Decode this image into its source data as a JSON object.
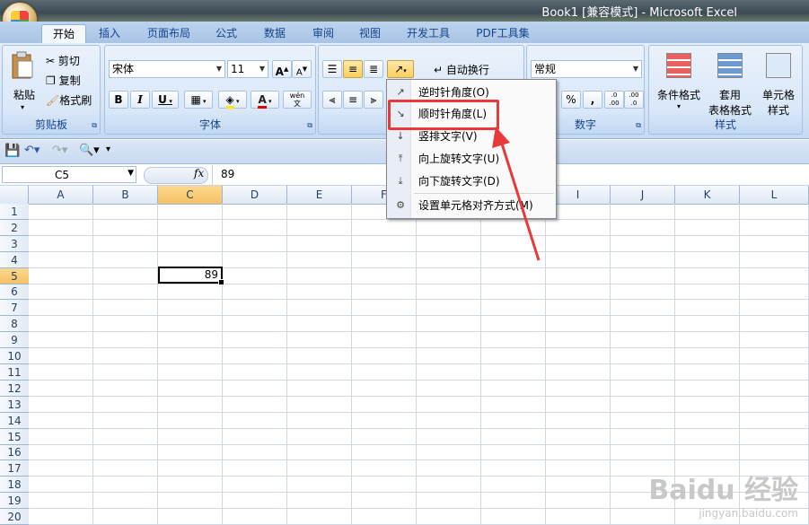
{
  "window": {
    "title": "Book1  [兼容模式] - Microsoft Excel"
  },
  "tabs": [
    "开始",
    "插入",
    "页面布局",
    "公式",
    "数据",
    "审阅",
    "视图",
    "开发工具",
    "PDF工具集"
  ],
  "clipboard": {
    "paste": "粘贴",
    "cut": "剪切",
    "copy": "复制",
    "format_painter": "格式刷",
    "label": "剪贴板"
  },
  "font": {
    "name": "宋体",
    "size": "11",
    "bold": "B",
    "italic": "I",
    "underline": "U",
    "font_color_glyph": "A",
    "phonetic": "wén",
    "label": "字体"
  },
  "alignment": {
    "wrap_text": "自动换行"
  },
  "number": {
    "format": "常规",
    "percent": "%",
    "comma": ",",
    "inc_decimal": ".0 .00",
    "dec_decimal": ".00 .0",
    "label": "数字"
  },
  "styles": {
    "conditional": "条件格式",
    "table_format_1": "套用",
    "table_format_2": "表格格式",
    "cell_styles_1": "单元格",
    "cell_styles_2": "样式",
    "label": "样式"
  },
  "formula_bar": {
    "name_box": "C5",
    "fx": "fx",
    "value": "89"
  },
  "columns": [
    "A",
    "B",
    "C",
    "D",
    "E",
    "F",
    "G",
    "H",
    "I",
    "J",
    "K",
    "L"
  ],
  "rows": [
    "1",
    "2",
    "3",
    "4",
    "5",
    "6",
    "7",
    "8",
    "9",
    "10",
    "11",
    "12",
    "13",
    "14",
    "15",
    "16",
    "17",
    "18",
    "19",
    "20"
  ],
  "cells": {
    "C5": "89"
  },
  "orientation_menu": [
    {
      "label": "逆时针角度(O)",
      "icon": "rotate-ccw-icon"
    },
    {
      "label": "顺时针角度(L)",
      "icon": "rotate-cw-icon"
    },
    {
      "label": "竖排文字(V)",
      "icon": "vertical-text-icon"
    },
    {
      "label": "向上旋转文字(U)",
      "icon": "rotate-up-icon"
    },
    {
      "label": "向下旋转文字(D)",
      "icon": "rotate-down-icon"
    },
    {
      "label": "设置单元格对齐方式(M)",
      "icon": "format-alignment-icon"
    }
  ],
  "watermark": {
    "brand": "Baidu 经验",
    "url": "jingyan.baidu.com"
  },
  "colors": {
    "highlight_red": "#e83a3a",
    "selected_header": "#f6c266",
    "ribbon_blue": "#d4e3f5"
  }
}
